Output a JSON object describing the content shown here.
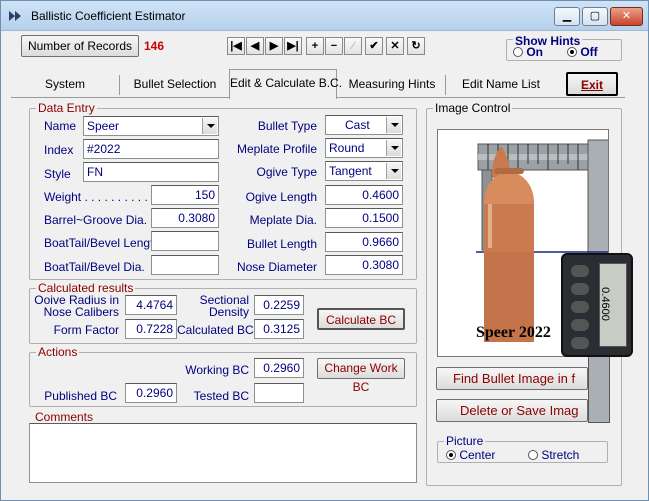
{
  "window": {
    "title": "Ballistic Coefficient Estimator"
  },
  "toolbar": {
    "num_records_label": "Number of Records",
    "num_records_value": "146",
    "nav_glyphs": [
      "|◀",
      "◀",
      "▶",
      "▶|",
      "+",
      "−",
      "⁄",
      "✔",
      "✕",
      "↻"
    ]
  },
  "hints": {
    "label": "Show Hints",
    "on": "On",
    "off": "Off"
  },
  "tabs": [
    "System",
    "Bullet Selection",
    "Edit & Calculate B.C.",
    "Measuring Hints",
    "Edit Name List"
  ],
  "exit_label": "Exit",
  "data_entry": {
    "legend": "Data Entry",
    "name_label": "Name",
    "name_value": "Speer",
    "index_label": "Index",
    "index_value": "#2022",
    "style_label": "Style",
    "style_value": "FN",
    "weight_label": "Weight . . . . . . . . . . . .",
    "weight_value": "150",
    "barrel_label": "Barrel~Groove Dia. . . .",
    "barrel_value": "0.3080",
    "boattail_len_label": "BoatTail/Bevel Length",
    "boattail_len_value": "",
    "boattail_dia_label": "BoatTail/Bevel Dia.",
    "boattail_dia_value": "",
    "bullet_type_label": "Bullet Type",
    "bullet_type_value": "Cast",
    "meplate_profile_label": "Meplate Profile",
    "meplate_profile_value": "Round",
    "ogive_type_label": "Ogive Type",
    "ogive_type_value": "Tangent",
    "ogive_length_label": "Ogive Length",
    "ogive_length_value": "0.4600",
    "meplate_dia_label": "Meplate Dia.",
    "meplate_dia_value": "0.1500",
    "bullet_length_label": "Bullet Length",
    "bullet_length_value": "0.9660",
    "nose_dia_label": "Nose Diameter",
    "nose_dia_value": "0.3080"
  },
  "calculated": {
    "legend": "Calculated results",
    "ogive_radius_label": "Ooive Radius in Nose Calibers",
    "ogive_radius_value": "4.4764",
    "sectional_label": "Sectional Density",
    "sectional_value": "0.2259",
    "form_factor_label": "Form Factor",
    "form_factor_value": "0.7228",
    "calc_bc_label": "Calculated BC",
    "calc_bc_value": "0.3125",
    "calc_button": "Calculate BC"
  },
  "actions": {
    "legend": "Actions",
    "working_bc_label": "Working BC",
    "working_bc_value": "0.2960",
    "change_button": "Change Work BC",
    "published_label": "Published BC",
    "published_value": "0.2960",
    "tested_label": "Tested BC",
    "tested_value": ""
  },
  "comments": {
    "legend": "Comments",
    "value": ""
  },
  "image_control": {
    "legend": "Image Control",
    "caption": "Speer 2022",
    "caliper_reading": "0.4600",
    "find_button": "Find Bullet Image in f",
    "delete_button": "Delete or Save Imag",
    "picture_legend": "Picture",
    "center_label": "Center",
    "stretch_label": "Stretch"
  },
  "colors": {
    "label_blue": "#000080",
    "legend_red": "#8b0000",
    "count_red": "#cc0000",
    "bullet_copper": "#c97a4e"
  }
}
